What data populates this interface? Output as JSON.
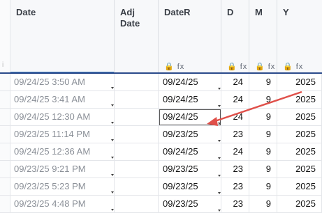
{
  "columns": [
    {
      "key": "date",
      "title": "Date",
      "icons": ""
    },
    {
      "key": "adj",
      "title": "Adj Date",
      "icons": ""
    },
    {
      "key": "dater",
      "title": "DateR",
      "icons": "🔒 fx"
    },
    {
      "key": "d",
      "title": "D",
      "icons": "🔒 fx"
    },
    {
      "key": "m",
      "title": "M",
      "icons": "🔒 fx"
    },
    {
      "key": "y",
      "title": "Y",
      "icons": "🔒 fx"
    }
  ],
  "row_marker": "i",
  "rows": [
    {
      "date": "09/24/25 3:50 AM",
      "adj": "",
      "dater": "09/24/25",
      "d": "24",
      "m": "9",
      "y": "2025"
    },
    {
      "date": "09/24/25 3:41 AM",
      "adj": "",
      "dater": "09/24/25",
      "d": "24",
      "m": "9",
      "y": "2025"
    },
    {
      "date": "09/24/25 12:30 AM",
      "adj": "",
      "dater": "09/24/25",
      "d": "24",
      "m": "9",
      "y": "2025"
    },
    {
      "date": "09/23/25 11:14 PM",
      "adj": "",
      "dater": "09/23/25",
      "d": "23",
      "m": "9",
      "y": "2025"
    },
    {
      "date": "09/24/25 12:36 AM",
      "adj": "",
      "dater": "09/24/25",
      "d": "24",
      "m": "9",
      "y": "2025"
    },
    {
      "date": "09/23/25 9:21 PM",
      "adj": "",
      "dater": "09/23/25",
      "d": "23",
      "m": "9",
      "y": "2025"
    },
    {
      "date": "09/23/25 5:23 PM",
      "adj": "",
      "dater": "09/23/25",
      "d": "23",
      "m": "9",
      "y": "2025"
    },
    {
      "date": "09/23/25 4:48 PM",
      "adj": "",
      "dater": "09/23/25",
      "d": "23",
      "m": "9",
      "y": "2025"
    }
  ],
  "selected_row": 2,
  "selected_col": "dater",
  "annotation_color": "#e0504a"
}
